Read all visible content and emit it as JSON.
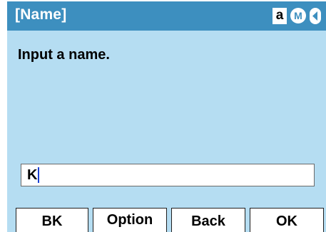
{
  "titlebar": {
    "title": "[Name]",
    "mode_alpha": "a",
    "mode_m": "M",
    "back_arrow_icon": "triangle-left-icon"
  },
  "content": {
    "prompt": "Input a name.",
    "input_value": "K"
  },
  "softkeys": {
    "key1": "BK",
    "key2": "Option",
    "key3": "Back",
    "key4": "OK"
  },
  "colors": {
    "titlebar_bg": "#3d8fbf",
    "body_bg": "#b5ddf2",
    "caret": "#1a3fd1"
  }
}
